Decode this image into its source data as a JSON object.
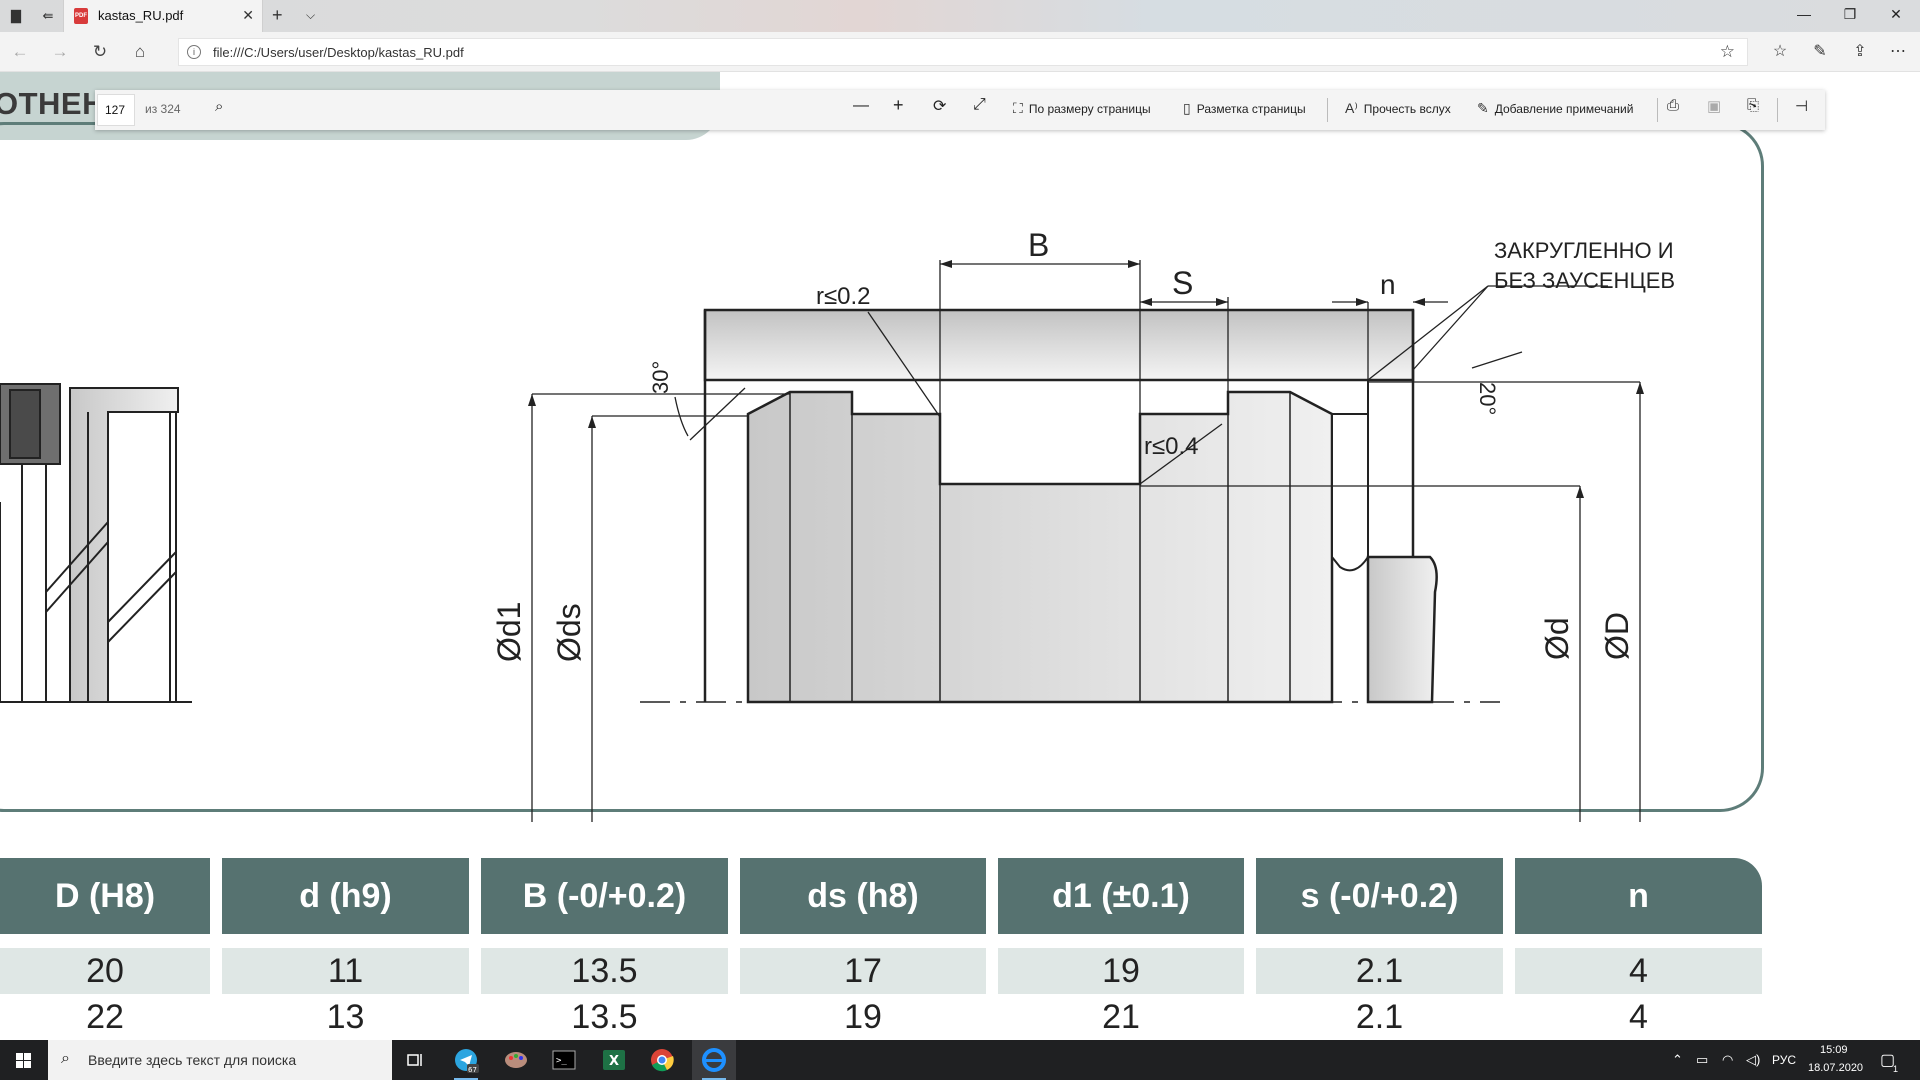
{
  "browser": {
    "tab_title": "kastas_RU.pdf",
    "url": "file:///C:/Users/user/Desktop/kastas_RU.pdf"
  },
  "pdf_toolbar": {
    "page_current": "127",
    "page_total": "из 324",
    "fit_page": "По размеру страницы",
    "page_layout": "Разметка страницы",
    "read_aloud": "Прочесть вслух",
    "add_notes": "Добавление примечаний"
  },
  "document": {
    "header_text": "ОТНЕНИ",
    "drawing_labels": {
      "b": "B",
      "s": "S",
      "n": "n",
      "r02": "r≤0.2",
      "r04": "r≤0.4",
      "angle30": "30°",
      "angle20": "20°",
      "rounded_line1": "ЗАКРУГЛЕННО И",
      "rounded_line2": "БЕЗ ЗАУСЕНЦЕВ",
      "d1": "Ød1",
      "ds": "Øds",
      "d": "Ød",
      "D": "ØD"
    },
    "table": {
      "headers": [
        "D (H8)",
        "d (h9)",
        "B (-0/+0.2)",
        "ds (h8)",
        "d1 (±0.1)",
        "s (-0/+0.2)",
        "n"
      ],
      "rows": [
        [
          "20",
          "11",
          "13.5",
          "17",
          "19",
          "2.1",
          "4"
        ],
        [
          "22",
          "13",
          "13.5",
          "19",
          "21",
          "2.1",
          "4"
        ]
      ]
    }
  },
  "taskbar": {
    "search_placeholder": "Введите здесь текст для поиска",
    "language": "РУС",
    "time": "15:09",
    "date": "18.07.2020",
    "notification_count": "1",
    "telegram_badge": "67"
  },
  "colors": {
    "accent_dark": "#567270",
    "band": "#c6d4d1",
    "row_fill": "#dfe7e5",
    "taskbar": "#1f2022"
  }
}
